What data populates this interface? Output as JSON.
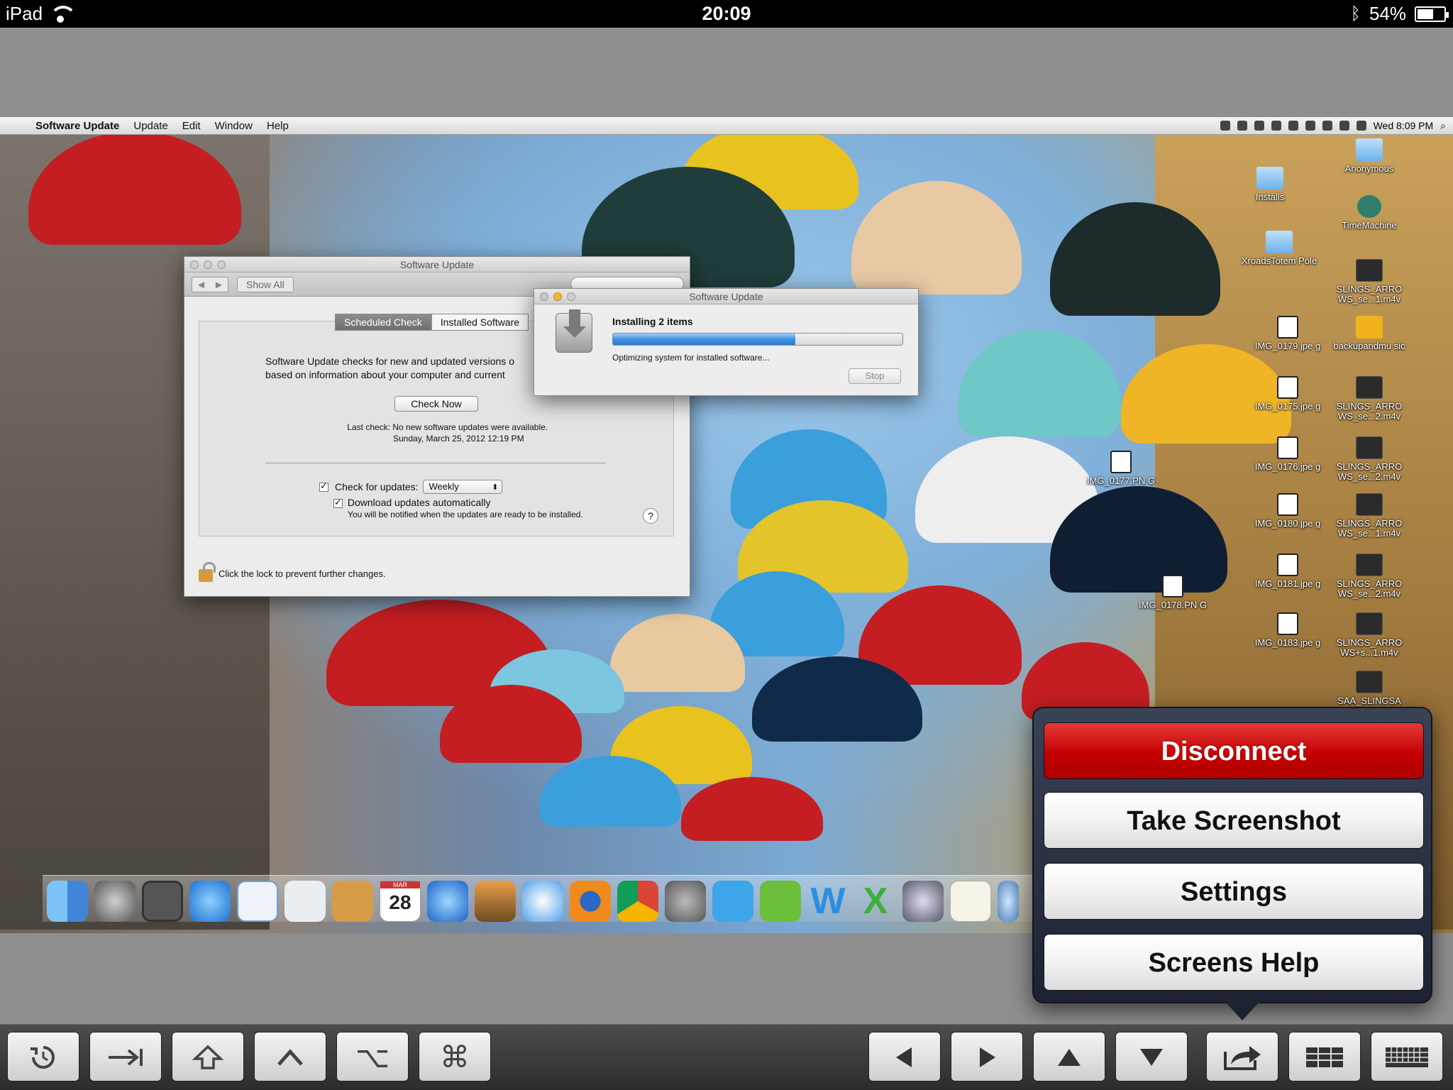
{
  "ios_status": {
    "device": "iPad",
    "time": "20:09",
    "battery": "54%",
    "bluetooth_icon": "bluetooth-icon"
  },
  "mac": {
    "menubar": {
      "app_name": "Software Update",
      "menus": [
        "Update",
        "Edit",
        "Window",
        "Help"
      ],
      "clock": "Wed 8:09 PM"
    },
    "sw_main": {
      "title": "Software Update",
      "show_all": "Show All",
      "tab_scheduled": "Scheduled Check",
      "tab_installed": "Installed Software",
      "desc_line1": "Software Update checks for new and updated versions o",
      "desc_line2": "based on information about your computer and current",
      "check_now": "Check Now",
      "last_check_label": "Last check:",
      "last_check_text": "No new software updates were available.",
      "last_check_date": "Sunday, March 25, 2012 12:19 PM",
      "check_updates_label": "Check for updates:",
      "frequency": "Weekly",
      "download_label": "Download updates automatically",
      "notify_note": "You will be notified when the updates are ready to be installed.",
      "help": "?",
      "lock_text": "Click the lock to prevent further changes."
    },
    "sw_progress": {
      "title": "Software Update",
      "heading": "Installing 2 items",
      "status": "Optimizing system for installed software...",
      "progress": 0.63,
      "stop": "Stop"
    },
    "desktop_icons": [
      {
        "label": "Anonymous",
        "kind": "folder"
      },
      {
        "label": "Installs",
        "kind": "folder"
      },
      {
        "label": "TimeMachine",
        "kind": "tm"
      },
      {
        "label": "XroadsTotem Pole",
        "kind": "folder"
      },
      {
        "label": "SLINGS_ARRO WS_se...1.m4v",
        "kind": "video"
      },
      {
        "label": "IMG_0179.jpe g",
        "kind": "doc"
      },
      {
        "label": "backupandmu sic",
        "kind": "zip"
      },
      {
        "label": "IMG_0175.jpe g",
        "kind": "doc"
      },
      {
        "label": "SLINGS_ARRO WS_se...2.m4v",
        "kind": "video"
      },
      {
        "label": "IMG_0177.PN G",
        "kind": "doc"
      },
      {
        "label": "IMG_0176.jpe g",
        "kind": "doc"
      },
      {
        "label": "SLINGS_ARRO WS_se...2.m4v",
        "kind": "video"
      },
      {
        "label": "IMG_0180.jpe g",
        "kind": "doc"
      },
      {
        "label": "SLINGS_ARRO WS_se...1.m4v",
        "kind": "video"
      },
      {
        "label": "IMG_0181.jpe g",
        "kind": "doc"
      },
      {
        "label": "SLINGS_ARRO WS_se...2.m4v",
        "kind": "video"
      },
      {
        "label": "IMG_0178.PN G",
        "kind": "doc"
      },
      {
        "label": "IMG_0183.jpe g",
        "kind": "doc"
      },
      {
        "label": "SLINGS_ARRO WS+s...1.m4v",
        "kind": "video"
      },
      {
        "label": "SAA_SLINGSA",
        "kind": "video"
      }
    ],
    "dock": [
      "finder-icon",
      "launchpad-icon",
      "photo-booth-icon",
      "app-store-icon",
      "mail-icon",
      "preview-icon",
      "address-book-icon",
      "calendar-icon",
      "itunes-icon",
      "iphoto-icon",
      "safari-icon",
      "firefox-icon",
      "chrome-icon",
      "system-preferences-icon",
      "twitter-icon",
      "evernote-icon",
      "word-icon",
      "excel-icon",
      "script-editor-icon",
      "textedit-icon",
      "downloads-icon"
    ],
    "calendar_day": "28",
    "calendar_month": "MAR"
  },
  "popover": {
    "disconnect": "Disconnect",
    "screenshot": "Take Screenshot",
    "settings": "Settings",
    "help": "Screens Help"
  },
  "toolbar": {
    "left": [
      "refresh-icon",
      "tab-key-icon",
      "shift-key-icon",
      "control-key-icon",
      "option-key-icon",
      "command-key-icon"
    ],
    "right": [
      "arrow-left-icon",
      "arrow-right-icon",
      "arrow-up-icon",
      "arrow-down-icon",
      "share-icon",
      "grid-icon",
      "keyboard-icon"
    ],
    "command_glyph": "⌘",
    "option_glyph": "⌥"
  },
  "colors": {
    "danger": "#c40000",
    "popover_bg": "#1d2232",
    "progress_fill": "#3f8fe0"
  }
}
